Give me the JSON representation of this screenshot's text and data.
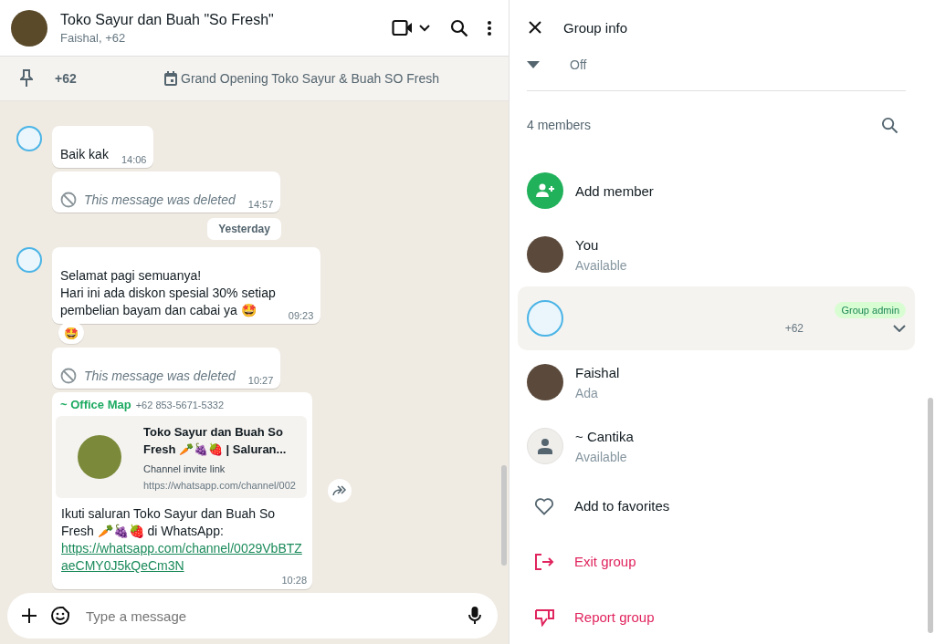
{
  "chat": {
    "title": "Toko Sayur dan Buah \"So Fresh\"",
    "subtitle": "Faishal, +62"
  },
  "pinned": {
    "sender": "+62",
    "text": "Grand Opening Toko Sayur & Buah SO Fresh"
  },
  "messages": [
    {
      "kind": "text",
      "avatar": true,
      "text": "Baik kak",
      "time": "14:06"
    },
    {
      "kind": "deleted",
      "avatar": false,
      "text": "This message was deleted",
      "time": "14:57"
    },
    {
      "kind": "date",
      "text": "Yesterday"
    },
    {
      "kind": "text",
      "avatar": true,
      "text": "Selamat pagi semuanya!\nHari ini ada diskon spesial 30% setiap\npembelian bayam dan cabai ya 🤩",
      "time": "09:23",
      "reaction": "🤩"
    },
    {
      "kind": "deleted",
      "avatar": false,
      "text": "This message was deleted",
      "time": "10:27"
    },
    {
      "kind": "link",
      "avatar": false,
      "sender": "~ Office Map",
      "phone": "+62 853-5671-5332",
      "preview_title": "Toko Sayur dan Buah So Fresh 🥕🍇🍓 | Saluran...",
      "preview_subtitle": "Channel invite link",
      "preview_url": "https://whatsapp.com/channel/002",
      "text": "Ikuti saluran Toko Sayur dan Buah So Fresh 🥕🍇🍓 di WhatsApp:",
      "link": "https://whatsapp.com/channel/0029VbBTZaeCMY0J5kQeCm3N",
      "time": "10:28"
    }
  ],
  "composer": {
    "placeholder": "Type a message"
  },
  "group_info": {
    "title": "Group info",
    "setting_value": "Off",
    "member_count": "4 members",
    "add_member": "Add member",
    "members": [
      {
        "kind": "photo",
        "name": "You",
        "status": "Available",
        "highlighted": false
      },
      {
        "kind": "illustration",
        "phone": "+62",
        "badge": "Group admin",
        "highlighted": true
      },
      {
        "kind": "photo",
        "name": "Faishal",
        "status": "Ada",
        "highlighted": false
      },
      {
        "kind": "placeholder",
        "name": "~ Cantika",
        "status": "Available",
        "highlighted": false
      }
    ],
    "actions": [
      {
        "label": "Add to favorites",
        "kind": "normal"
      },
      {
        "label": "Exit group",
        "kind": "danger"
      },
      {
        "label": "Report group",
        "kind": "danger"
      }
    ]
  }
}
